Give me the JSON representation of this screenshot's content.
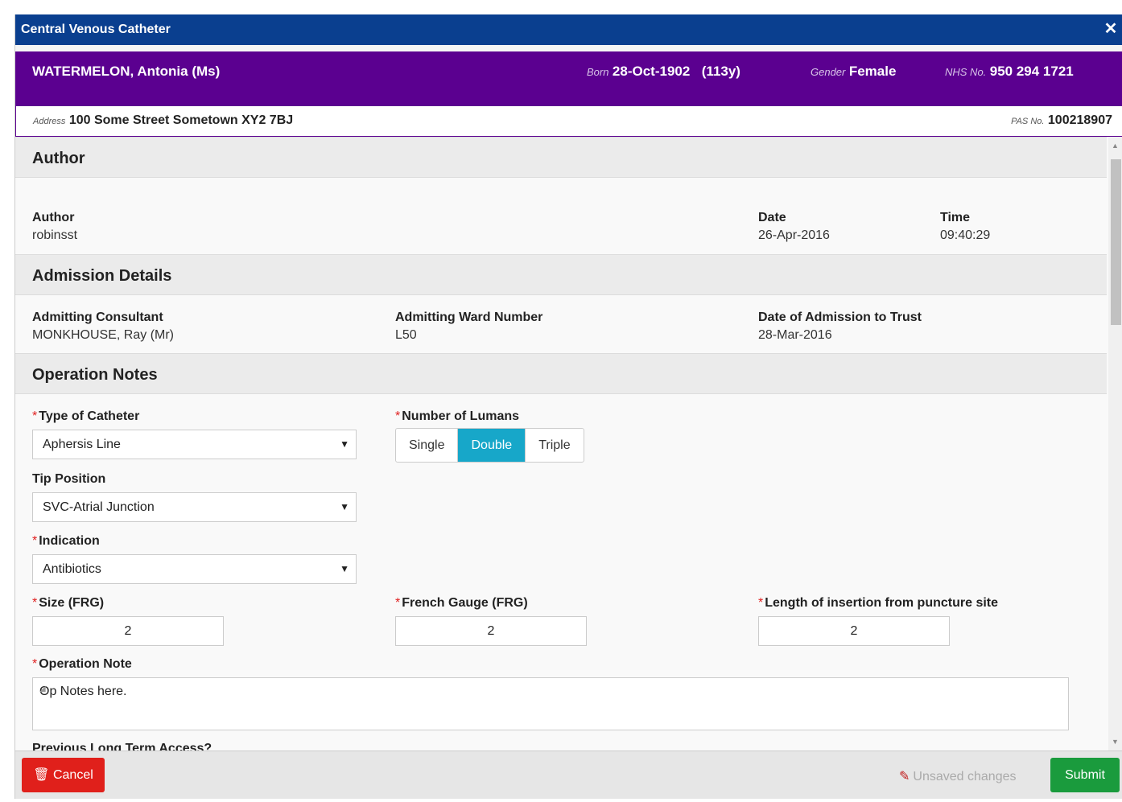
{
  "dialog": {
    "title": "Central Venous Catheter",
    "close_icon": "close-icon"
  },
  "patient": {
    "name": "WATERMELON, Antonia (Ms)",
    "born_label": "Born",
    "born_value": "28-Oct-1902",
    "age": "(113y)",
    "gender_label": "Gender",
    "gender_value": "Female",
    "nhs_label": "NHS No.",
    "nhs_value": "950 294 1721",
    "address_label": "Address",
    "address_value": "100 Some Street Sometown XY2 7BJ",
    "pas_label": "PAS No.",
    "pas_value": "100218907"
  },
  "author_section": {
    "heading": "Author",
    "author_label": "Author",
    "author_value": "robinsst",
    "date_label": "Date",
    "date_value": "26-Apr-2016",
    "time_label": "Time",
    "time_value": "09:40:29"
  },
  "admission_section": {
    "heading": "Admission Details",
    "consultant_label": "Admitting Consultant",
    "consultant_value": "MONKHOUSE, Ray (Mr)",
    "ward_label": "Admitting Ward Number",
    "ward_value": "L50",
    "admission_date_label": "Date of Admission to Trust",
    "admission_date_value": "28-Mar-2016"
  },
  "operation_section": {
    "heading": "Operation Notes",
    "catheter_type_label": "Type of Catheter",
    "catheter_type_value": "Aphersis Line",
    "lumans_label": "Number of Lumans",
    "lumans_options": [
      "Single",
      "Double",
      "Triple"
    ],
    "lumans_selected": "Double",
    "tip_position_label": "Tip Position",
    "tip_position_value": "SVC-Atrial Junction",
    "indication_label": "Indication",
    "indication_value": "Antibiotics",
    "size_label": "Size (FRG)",
    "size_value": "2",
    "french_gauge_label": "French Gauge (FRG)",
    "french_gauge_value": "2",
    "length_label": "Length of insertion from puncture site",
    "length_value": "2",
    "op_note_label": "Operation Note",
    "op_note_value": "Op Notes here.",
    "prev_access_label": "Previous Long Term Access?",
    "required_mark": "*"
  },
  "footer": {
    "cancel_label": "Cancel",
    "unsaved_label": "Unsaved changes",
    "submit_label": "Submit"
  },
  "colors": {
    "titlebar": "#0a3f8f",
    "banner": "#5b0090",
    "accent": "#17a7c9",
    "cancel": "#e0201b",
    "submit": "#1a9b3d"
  }
}
